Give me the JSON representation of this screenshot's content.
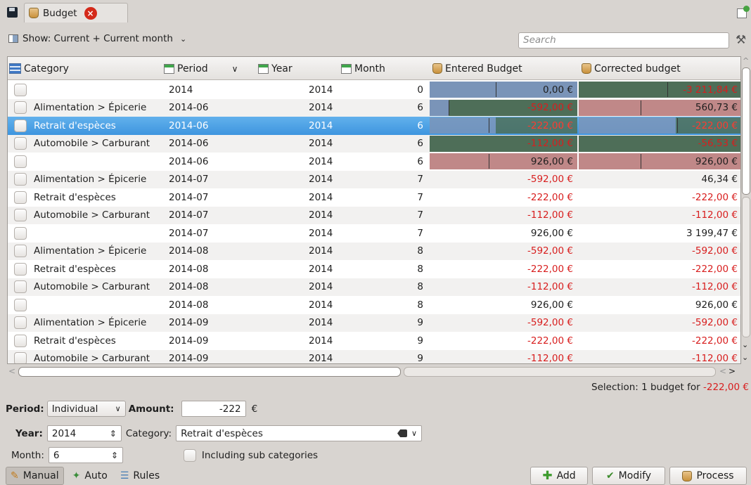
{
  "tab": {
    "title": "Budget"
  },
  "toolbar": {
    "show_label": "Show: Current + Current month",
    "search_placeholder": "Search"
  },
  "table": {
    "headers": {
      "category": "Category",
      "period": "Period",
      "year": "Year",
      "month": "Month",
      "entered": "Entered Budget",
      "corrected": "Corrected budget"
    },
    "rows": [
      {
        "category": "",
        "period": "2014",
        "year": "2014",
        "month": "0",
        "entered": "0,00 €",
        "corrected": "-3 211,84 €",
        "entered_neg": false,
        "corrected_neg": true
      },
      {
        "category": "Alimentation > Épicerie",
        "period": "2014-06",
        "year": "2014",
        "month": "6",
        "entered": "-592,00 €",
        "corrected": "560,73 €",
        "entered_neg": true,
        "corrected_neg": false
      },
      {
        "category": "Retrait d'espèces",
        "period": "2014-06",
        "year": "2014",
        "month": "6",
        "entered": "-222,00 €",
        "corrected": "-222,00 €",
        "entered_neg": true,
        "corrected_neg": true,
        "selected": true
      },
      {
        "category": "Automobile > Carburant",
        "period": "2014-06",
        "year": "2014",
        "month": "6",
        "entered": "-112,00 €",
        "corrected": "-56,53 €",
        "entered_neg": true,
        "corrected_neg": true
      },
      {
        "category": "",
        "period": "2014-06",
        "year": "2014",
        "month": "6",
        "entered": "926,00 €",
        "corrected": "926,00 €",
        "entered_neg": false,
        "corrected_neg": false
      },
      {
        "category": "Alimentation > Épicerie",
        "period": "2014-07",
        "year": "2014",
        "month": "7",
        "entered": "-592,00 €",
        "corrected": "46,34 €",
        "entered_neg": true,
        "corrected_neg": false
      },
      {
        "category": "Retrait d'espèces",
        "period": "2014-07",
        "year": "2014",
        "month": "7",
        "entered": "-222,00 €",
        "corrected": "-222,00 €",
        "entered_neg": true,
        "corrected_neg": true
      },
      {
        "category": "Automobile > Carburant",
        "period": "2014-07",
        "year": "2014",
        "month": "7",
        "entered": "-112,00 €",
        "corrected": "-112,00 €",
        "entered_neg": true,
        "corrected_neg": true
      },
      {
        "category": "",
        "period": "2014-07",
        "year": "2014",
        "month": "7",
        "entered": "926,00 €",
        "corrected": "3 199,47 €",
        "entered_neg": false,
        "corrected_neg": false
      },
      {
        "category": "Alimentation > Épicerie",
        "period": "2014-08",
        "year": "2014",
        "month": "8",
        "entered": "-592,00 €",
        "corrected": "-592,00 €",
        "entered_neg": true,
        "corrected_neg": true
      },
      {
        "category": "Retrait d'espèces",
        "period": "2014-08",
        "year": "2014",
        "month": "8",
        "entered": "-222,00 €",
        "corrected": "-222,00 €",
        "entered_neg": true,
        "corrected_neg": true
      },
      {
        "category": "Automobile > Carburant",
        "period": "2014-08",
        "year": "2014",
        "month": "8",
        "entered": "-112,00 €",
        "corrected": "-112,00 €",
        "entered_neg": true,
        "corrected_neg": true
      },
      {
        "category": "",
        "period": "2014-08",
        "year": "2014",
        "month": "8",
        "entered": "926,00 €",
        "corrected": "926,00 €",
        "entered_neg": false,
        "corrected_neg": false
      },
      {
        "category": "Alimentation > Épicerie",
        "period": "2014-09",
        "year": "2014",
        "month": "9",
        "entered": "-592,00 €",
        "corrected": "-592,00 €",
        "entered_neg": true,
        "corrected_neg": true
      },
      {
        "category": "Retrait d'espèces",
        "period": "2014-09",
        "year": "2014",
        "month": "9",
        "entered": "-222,00 €",
        "corrected": "-222,00 €",
        "entered_neg": true,
        "corrected_neg": true
      },
      {
        "category": "Automobile > Carburant",
        "period": "2014-09",
        "year": "2014",
        "month": "9",
        "entered": "-112,00 €",
        "corrected": "-112,00 €",
        "entered_neg": true,
        "corrected_neg": true
      }
    ]
  },
  "status": {
    "prefix": "Selection: 1 budget for ",
    "amount": "-222,00 €"
  },
  "form": {
    "period_label": "Period:",
    "period_value": "Individual",
    "amount_label": "Amount:",
    "amount_value": "-222",
    "currency": "€",
    "year_label": "Year:",
    "year_value": "2014",
    "category_label": "Category:",
    "category_value": "Retrait d'espèces",
    "month_label": "Month:",
    "month_value": "6",
    "subcat_label": "Including sub categories"
  },
  "bottom": {
    "tabs": [
      "Manual",
      "Auto",
      "Rules"
    ],
    "add": "Add",
    "modify": "Modify",
    "process": "Process"
  },
  "colors": {
    "negative": "#d81e1e",
    "selection": "#3e95df",
    "bar_blue": "#7a94b8",
    "bar_green": "#4e6e58",
    "bar_red": "#c08888"
  }
}
